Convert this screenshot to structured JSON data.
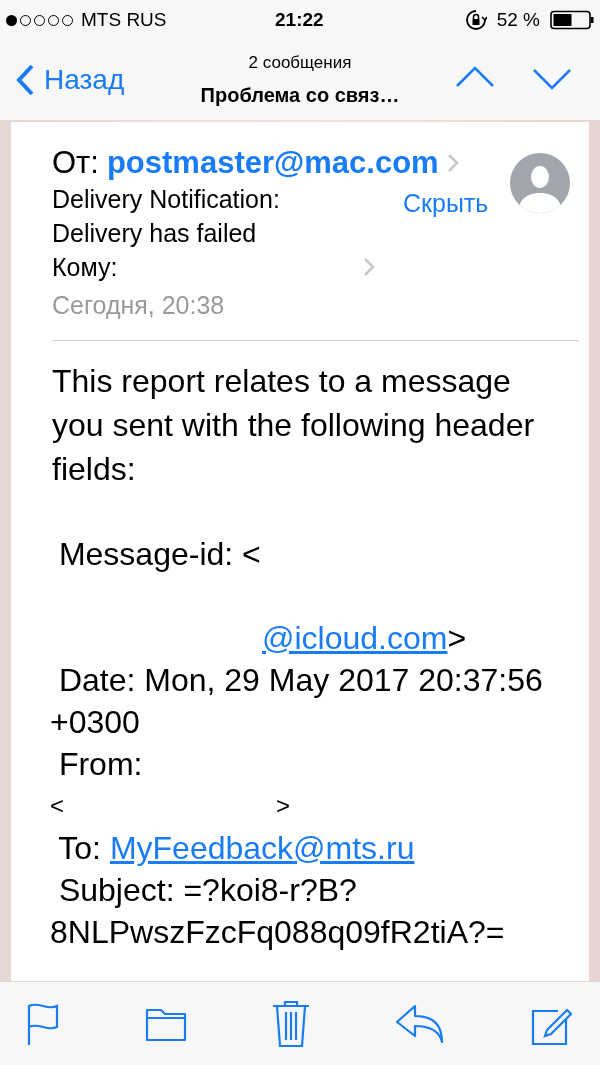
{
  "status_bar": {
    "carrier": "MTS RUS",
    "time": "21:22",
    "battery": "52 %"
  },
  "nav": {
    "back": "Назад",
    "count": "2 сообщения",
    "title": "Проблема со связ…"
  },
  "header": {
    "from_label": "От:",
    "from_address": "postmaster@mac.com",
    "subject_lines": [
      "Delivery Notification:",
      "Delivery has failed"
    ],
    "hide_link": "Скрыть",
    "to_label": "Кому:",
    "date": "Сегодня, 20:38"
  },
  "body": {
    "paragraph": "This report relates to a message you sent with the following header fields:",
    "lines": [
      {
        "parts": [
          {
            "kind": "text",
            "text": " Message-id: <"
          }
        ]
      },
      {
        "parts": [
          {
            "kind": "redacted"
          }
        ]
      },
      {
        "parts": [
          {
            "kind": "redacted"
          },
          {
            "kind": "link",
            "text": "@icloud.com"
          },
          {
            "kind": "text",
            "text": ">"
          }
        ]
      },
      {
        "parts": [
          {
            "kind": "text",
            "text": " Date: Mon, 29 May 2017 20:37:56"
          }
        ]
      },
      {
        "parts": [
          {
            "kind": "text",
            "text": "+0300"
          }
        ]
      },
      {
        "parts": [
          {
            "kind": "text",
            "text": " From:"
          }
        ]
      },
      {
        "parts": [
          {
            "kind": "small",
            "text": "<"
          },
          {
            "kind": "redacted"
          },
          {
            "kind": "small",
            "text": ">"
          }
        ]
      },
      {
        "parts": [
          {
            "kind": "text",
            "text": " To: "
          },
          {
            "kind": "link",
            "text": "MyFeedback@mts.ru"
          }
        ]
      },
      {
        "parts": [
          {
            "kind": "text",
            "text": " Subject: =?koi8-r?B?"
          }
        ]
      },
      {
        "parts": [
          {
            "kind": "text",
            "text": "8NLPwszFzcFq088q09fR2tiA?="
          }
        ]
      }
    ]
  },
  "toolbar": [
    {
      "kind": "flag"
    },
    {
      "kind": "folder"
    },
    {
      "kind": "trash"
    },
    {
      "kind": "reply"
    },
    {
      "kind": "compose"
    }
  ]
}
